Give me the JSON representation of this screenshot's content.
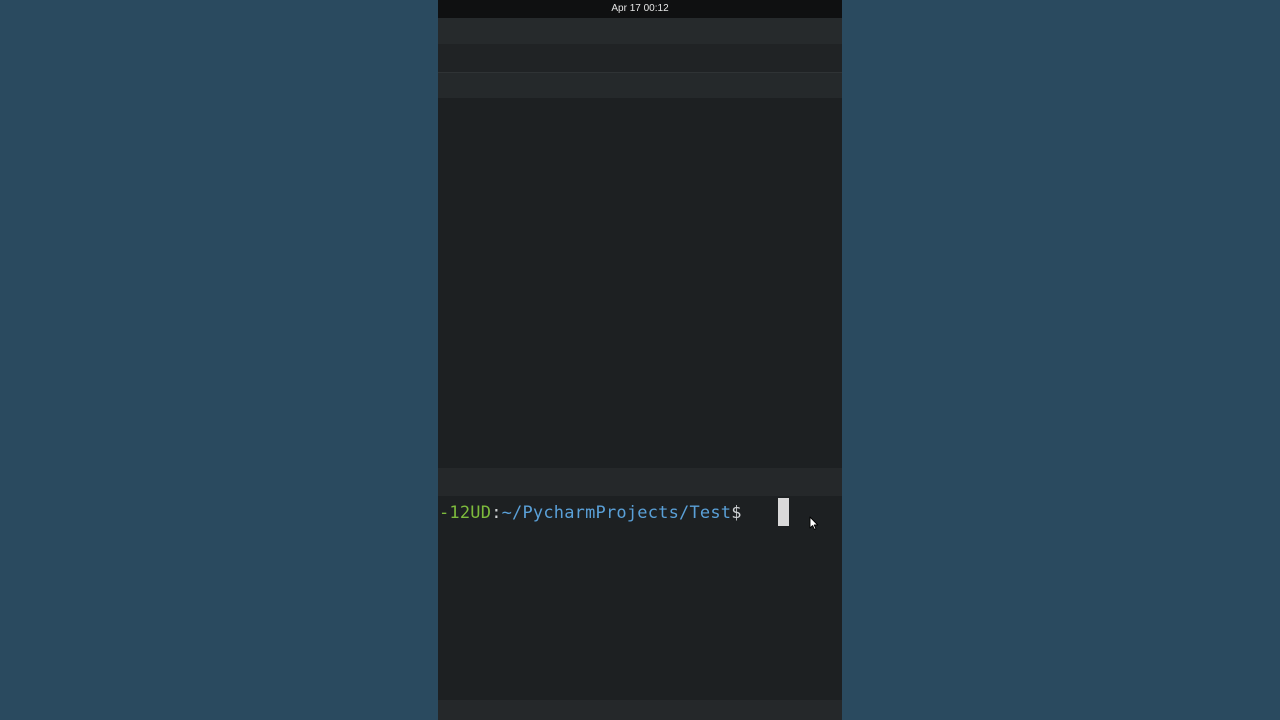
{
  "topbar": {
    "datetime": "Apr 17  00:12"
  },
  "terminal": {
    "prompt_host_fragment": "-12UD",
    "prompt_colon": ":",
    "prompt_path": "~/PycharmProjects/Test",
    "prompt_dollar": "$"
  },
  "colors": {
    "background": "#2a4a5f",
    "terminal_bg": "#1d2022",
    "host_green": "#7dbb3c",
    "path_blue": "#5aa0d8",
    "cursor": "#d9d9d9"
  },
  "icons": {
    "pointer": "mouse-pointer-icon"
  }
}
